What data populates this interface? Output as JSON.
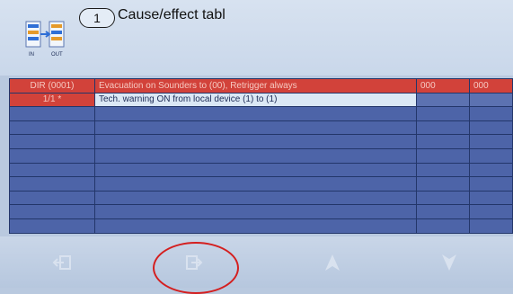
{
  "header": {
    "step_number": "1",
    "title": "Cause/effect tabl",
    "logo_in_label": "IN",
    "logo_out_label": "OUT"
  },
  "table": {
    "rows": [
      {
        "type": "red",
        "cells": [
          "DIR (0001)",
          "Evacuation on Sounders to (00), Retrigger always",
          "000",
          "000"
        ]
      },
      {
        "type": "active",
        "cells": [
          "1/1 *",
          "Tech. warning ON from local device (1) to (1)",
          "",
          ""
        ]
      },
      {
        "type": "empty",
        "cells": [
          "",
          "",
          "",
          ""
        ]
      },
      {
        "type": "empty",
        "cells": [
          "",
          "",
          "",
          ""
        ]
      },
      {
        "type": "empty",
        "cells": [
          "",
          "",
          "",
          ""
        ]
      },
      {
        "type": "empty",
        "cells": [
          "",
          "",
          "",
          ""
        ]
      },
      {
        "type": "empty",
        "cells": [
          "",
          "",
          "",
          ""
        ]
      },
      {
        "type": "empty",
        "cells": [
          "",
          "",
          "",
          ""
        ]
      },
      {
        "type": "empty",
        "cells": [
          "",
          "",
          "",
          ""
        ]
      },
      {
        "type": "empty",
        "cells": [
          "",
          "",
          "",
          ""
        ]
      },
      {
        "type": "empty",
        "cells": [
          "",
          "",
          "",
          ""
        ]
      }
    ]
  },
  "toolbar": {
    "buttons": [
      {
        "name": "exit-button",
        "icon": "exit-icon"
      },
      {
        "name": "enter-button",
        "icon": "enter-icon"
      },
      {
        "name": "up-button",
        "icon": "arrow-up-icon"
      },
      {
        "name": "down-button",
        "icon": "arrow-down-icon"
      }
    ]
  },
  "colors": {
    "header_bg": "#d7e2f0",
    "row_red": "#d2423a",
    "row_empty": "#4d64a8",
    "row_active": "#dbe8f5",
    "annotation_circle": "#d41f1f"
  }
}
